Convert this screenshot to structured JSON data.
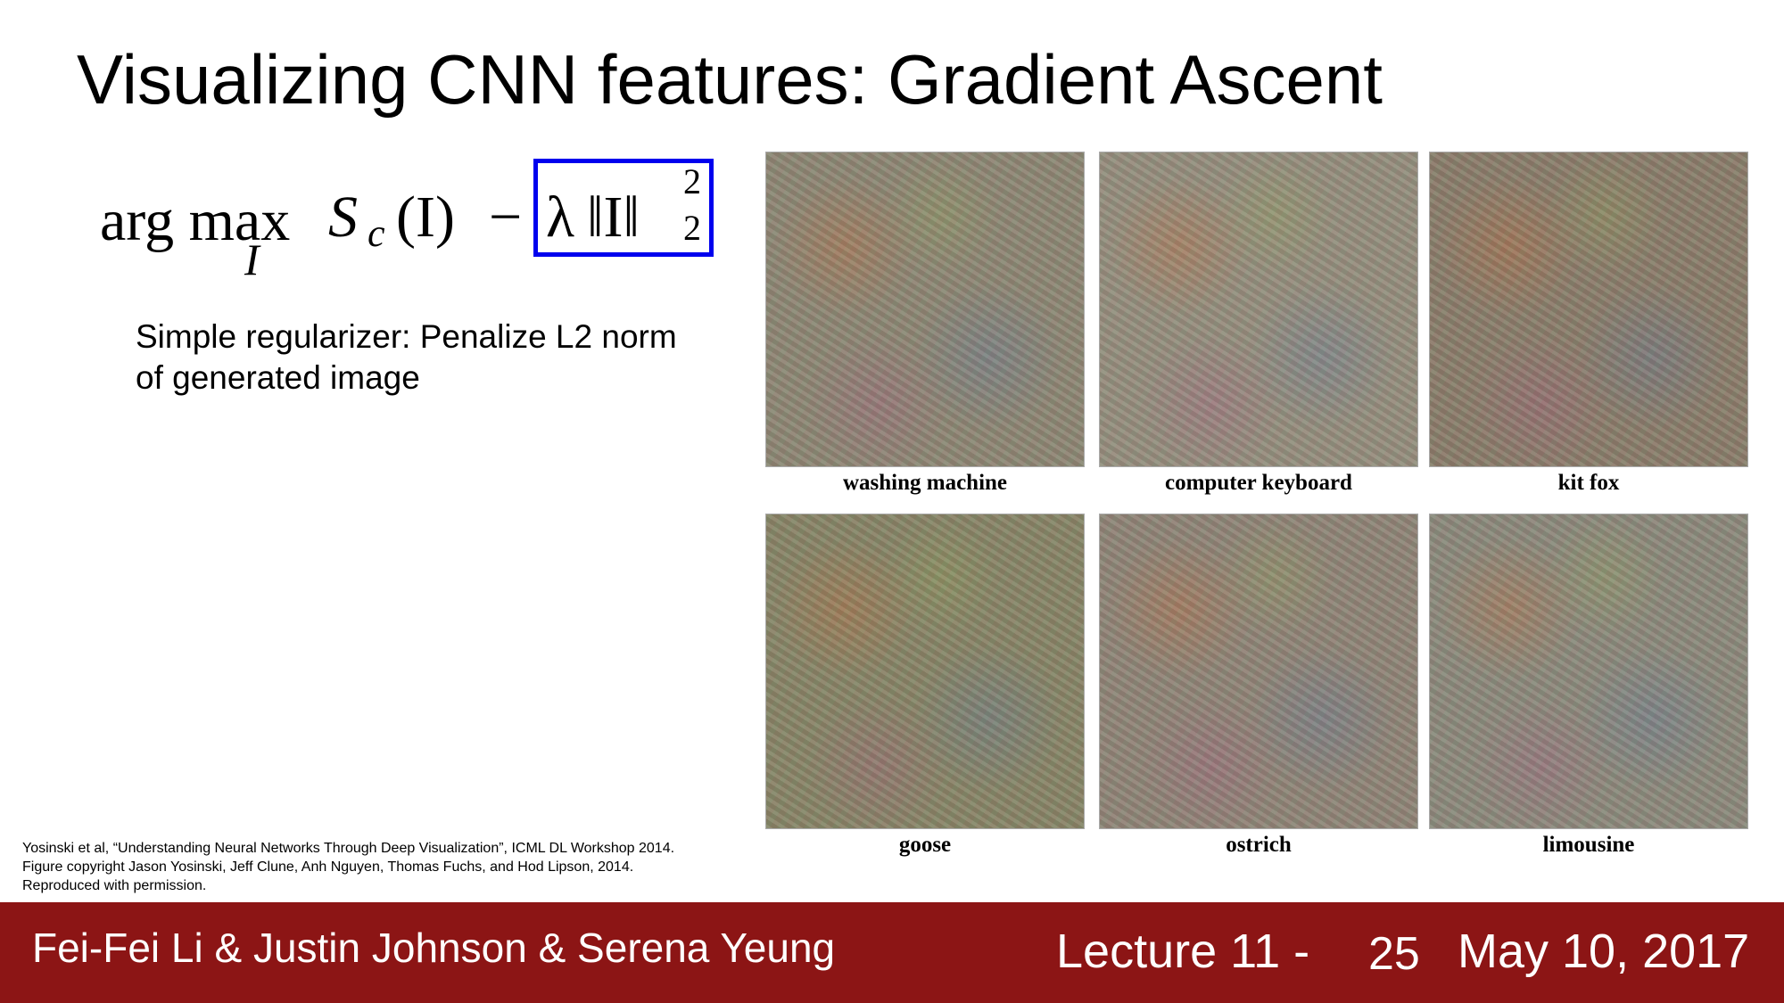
{
  "slide": {
    "title": "Visualizing CNN features: Gradient Ascent",
    "formula": {
      "operator": "arg max",
      "operator_subscript": "I",
      "score": "S",
      "score_subscript": "c",
      "score_argument": "(I)",
      "minus": "−",
      "lambda": "λ",
      "norm": "‖I‖",
      "norm_superscript": "2",
      "norm_subscript": "2",
      "highlight_color": "#0000ee"
    },
    "description": "Simple regularizer: Penalize L2 norm of generated image",
    "citation": [
      "Yosinski et al, “Understanding Neural Networks Through Deep Visualization”, ICML DL Workshop 2014.",
      "Figure copyright Jason Yosinski, Jeff Clune, Anh Nguyen, Thomas Fuchs, and Hod Lipson, 2014.",
      "Reproduced with permission."
    ],
    "visualizations": [
      {
        "label": "washing machine"
      },
      {
        "label": "computer keyboard"
      },
      {
        "label": "kit fox"
      },
      {
        "label": "goose"
      },
      {
        "label": "ostrich"
      },
      {
        "label": "limousine"
      }
    ]
  },
  "footer": {
    "authors": "Fei-Fei Li & Justin Johnson & Serena Yeung",
    "lecture": "Lecture 11 -",
    "page": "25",
    "date": "May 10, 2017",
    "background_color": "#8c1515"
  }
}
